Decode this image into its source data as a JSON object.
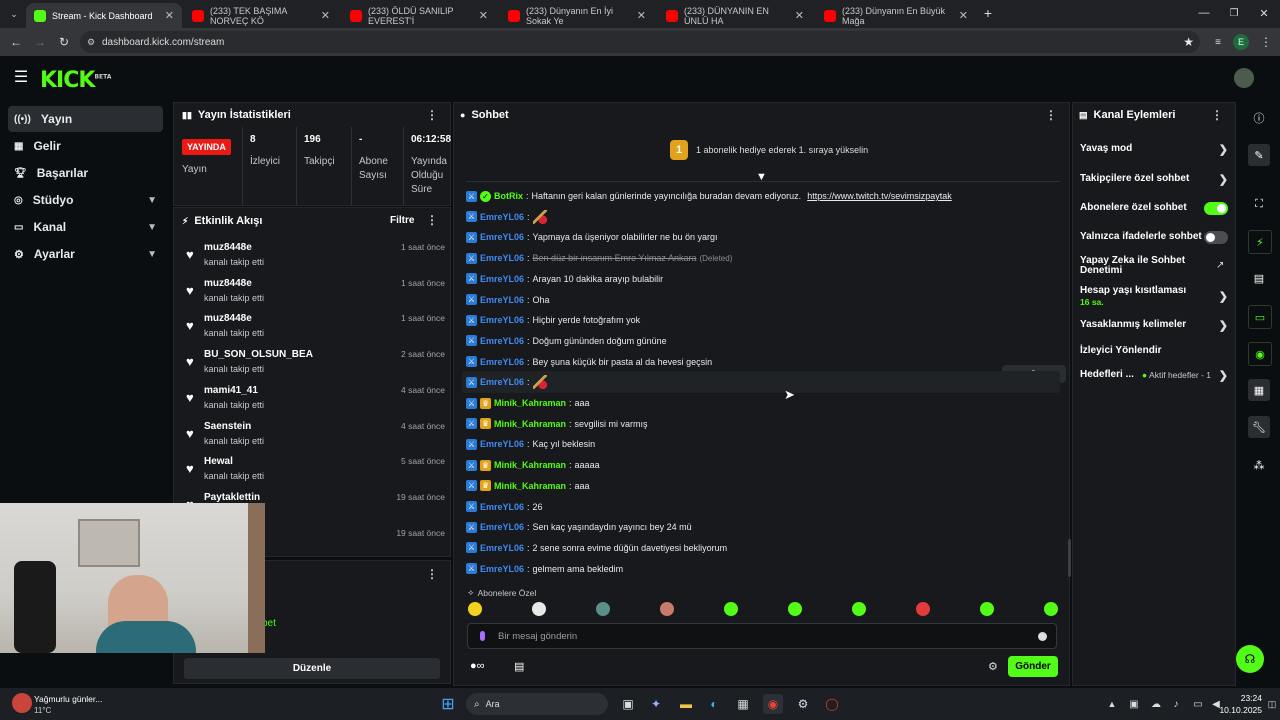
{
  "browser": {
    "tabs": [
      {
        "label": "Stream - Kick Dashboard",
        "active": true
      },
      {
        "label": "(233) TEK BAŞIMA NORVEÇ KÖ"
      },
      {
        "label": "(233) ÖLDÜ SANILIP EVEREST'İ"
      },
      {
        "label": "(233) Dünyanın En İyi Sokak Ye"
      },
      {
        "label": "(233) DÜNYANIN EN ÜNLÜ HA"
      },
      {
        "label": "(233) Dünyanın En Büyük Mağa"
      }
    ],
    "url": "dashboard.kick.com/stream",
    "profile_letter": "E"
  },
  "nav": {
    "items": [
      {
        "label": "Yayın",
        "active": true,
        "chevron": false
      },
      {
        "label": "Gelir",
        "chevron": false
      },
      {
        "label": "Başarılar",
        "chevron": false
      },
      {
        "label": "Stüdyo",
        "chevron": true
      },
      {
        "label": "Kanal",
        "chevron": true
      },
      {
        "label": "Ayarlar",
        "chevron": true
      }
    ]
  },
  "stats": {
    "title": "Yayın İstatistikleri",
    "live_label": "YAYINDA",
    "live_caption": "Yayın",
    "viewers": {
      "value": "8",
      "label": "İzleyici"
    },
    "followers": {
      "value": "196",
      "label": "Takipçi"
    },
    "subs": {
      "value": "-",
      "label": "Abone Sayısı"
    },
    "uptime": {
      "value": "06:12:58",
      "label": "Yayında Olduğu Süre"
    }
  },
  "activity": {
    "title": "Etkinlik Akışı",
    "filter_label": "Filtre",
    "items": [
      {
        "user": "muz8448e",
        "sub": "kanalı takip etti",
        "time": "1 saat önce"
      },
      {
        "user": "muz8448e",
        "sub": "kanalı takip etti",
        "time": "1 saat önce"
      },
      {
        "user": "muz8448e",
        "sub": "kanalı takip etti",
        "time": "1 saat önce"
      },
      {
        "user": "BU_SON_OLSUN_BEA",
        "sub": "kanalı takip etti",
        "time": "2 saat önce"
      },
      {
        "user": "mami41_41",
        "sub": "kanalı takip etti",
        "time": "4 saat önce"
      },
      {
        "user": "Saenstein",
        "sub": "kanalı takip etti",
        "time": "4 saat önce"
      },
      {
        "user": "Hewal",
        "sub": "kanalı takip etti",
        "time": "5 saat önce"
      },
      {
        "user": "Paytaklettin",
        "sub": "",
        "time": "19 saat önce"
      },
      {
        "user": "",
        "sub": "",
        "time": "19 saat önce"
      }
    ],
    "bottom_partial": "bet",
    "edit_label": "Düzenle"
  },
  "chat": {
    "title": "Sohbet",
    "gift_rank": "1",
    "gift_text": "1 abonelik hediye ederek 1. sıraya yükselin",
    "messages": [
      {
        "user": "BotRix",
        "color": "#53fc18",
        "badge": "bot",
        "text": "Haftanın geri kalan günlerinde yayıncılığa buradan devam ediyoruz.",
        "link": "https://www.twitch.tv/sevimsizpaytak"
      },
      {
        "user": "EmreYL06",
        "color": "#3f8bf5",
        "badge": "blue",
        "text": "",
        "emote": true
      },
      {
        "user": "EmreYL06",
        "color": "#3f8bf5",
        "badge": "blue",
        "text": "Yapmaya da üşeniyor olabilirler ne bu ön yargı"
      },
      {
        "user": "EmreYL06",
        "color": "#3f8bf5",
        "badge": "blue",
        "text": "Ben düz bir insanım Emre Yılmaz Ankara",
        "deleted": "(Deleted)"
      },
      {
        "user": "EmreYL06",
        "color": "#3f8bf5",
        "badge": "blue",
        "text": "Arayan 10 dakika arayıp bulabilir"
      },
      {
        "user": "EmreYL06",
        "color": "#3f8bf5",
        "badge": "blue",
        "text": "Oha"
      },
      {
        "user": "EmreYL06",
        "color": "#3f8bf5",
        "badge": "blue",
        "text": "Hiçbir yerde fotoğrafım yok"
      },
      {
        "user": "EmreYL06",
        "color": "#3f8bf5",
        "badge": "blue",
        "text": "Doğum gününden doğum gününe"
      },
      {
        "user": "EmreYL06",
        "color": "#3f8bf5",
        "badge": "blue",
        "text": "Bey şuna küçük bir pasta al da hevesi geçsin"
      },
      {
        "user": "EmreYL06",
        "color": "#3f8bf5",
        "badge": "blue",
        "text": "",
        "emote": true,
        "hover": true
      },
      {
        "user": "Minik_Kahraman",
        "color": "#53fc18",
        "badge": "gold",
        "text": "aaa"
      },
      {
        "user": "Minik_Kahraman",
        "color": "#53fc18",
        "badge": "gold",
        "text": "sevgilisi mi varmış"
      },
      {
        "user": "EmreYL06",
        "color": "#3f8bf5",
        "badge": "blue",
        "text": "Kaç yıl beklesin"
      },
      {
        "user": "Minik_Kahraman",
        "color": "#53fc18",
        "badge": "gold",
        "text": "aaaaa"
      },
      {
        "user": "Minik_Kahraman",
        "color": "#53fc18",
        "badge": "gold",
        "text": "aaa"
      },
      {
        "user": "EmreYL06",
        "color": "#3f8bf5",
        "badge": "blue",
        "text": "26"
      },
      {
        "user": "EmreYL06",
        "color": "#3f8bf5",
        "badge": "blue",
        "text": "Sen kaç yaşındaydın yayıncı bey 24 mü"
      },
      {
        "user": "EmreYL06",
        "color": "#3f8bf5",
        "badge": "blue",
        "text": "2 sene sonra evime düğün davetiyesi bekliyorum"
      },
      {
        "user": "EmreYL06",
        "color": "#3f8bf5",
        "badge": "blue",
        "text": "gelmem ama bekledim"
      }
    ],
    "subs_only_label": "Abonelere Özel",
    "input_placeholder": "Bir mesaj gönderin",
    "send_label": "Gönder"
  },
  "actions": {
    "title": "Kanal Eylemleri",
    "slow_mode": "Yavaş mod",
    "followers_only": "Takipçilere özel sohbet",
    "subs_only": "Abonelere özel sohbet",
    "emotes_only": "Yalnızca ifadelerle sohbet",
    "ai_moderation": "Yapay Zeka ile Sohbet Denetimi",
    "account_age": "Hesap yaşı kısıtlaması",
    "account_age_value": "16 sa.",
    "banned_words": "Yasaklanmış kelimeler",
    "viewer_redirect": "İzleyici Yönlendir",
    "goals": "Hedefleri ...",
    "goals_status": "Aktif hedefler - 1"
  },
  "taskbar": {
    "weather_title": "Yağmurlu günler...",
    "weather_temp": "11°C",
    "search_label": "Ara",
    "time": "23:24",
    "date": "10.10.2025"
  },
  "colors": {
    "accent": "#53fc18",
    "live": "#e91916",
    "panel": "#17191c",
    "bg": "#0b0e10"
  }
}
